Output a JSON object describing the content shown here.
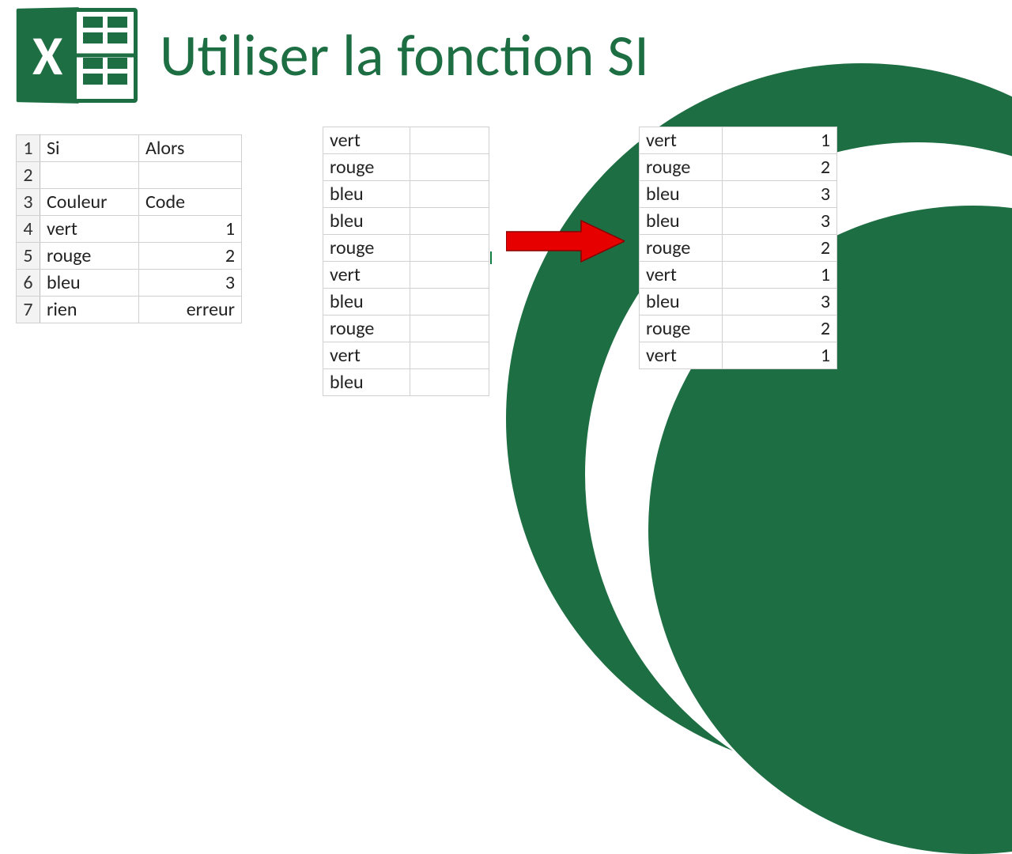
{
  "title": "Utiliser la fonction SI",
  "logo": {
    "letter": "X"
  },
  "colors": {
    "brand": "#1e6e43",
    "arrow": "#e60000"
  },
  "leftTable": {
    "rows": [
      {
        "n": "1",
        "a": "Si",
        "b": "Alors"
      },
      {
        "n": "2",
        "a": "",
        "b": ""
      },
      {
        "n": "3",
        "a": "Couleur",
        "b": "Code"
      },
      {
        "n": "4",
        "a": "vert",
        "b": "1"
      },
      {
        "n": "5",
        "a": "rouge",
        "b": "2"
      },
      {
        "n": "6",
        "a": "bleu",
        "b": "3"
      },
      {
        "n": "7",
        "a": "rien",
        "b": "erreur"
      }
    ]
  },
  "midTable": {
    "rows": [
      {
        "a": "vert",
        "b": ""
      },
      {
        "a": "rouge",
        "b": ""
      },
      {
        "a": "bleu",
        "b": ""
      },
      {
        "a": "bleu",
        "b": ""
      },
      {
        "a": "rouge",
        "b": ""
      },
      {
        "a": "vert",
        "b": ""
      },
      {
        "a": "bleu",
        "b": ""
      },
      {
        "a": "rouge",
        "b": ""
      },
      {
        "a": "vert",
        "b": ""
      },
      {
        "a": "bleu",
        "b": ""
      }
    ]
  },
  "rightTable": {
    "rows": [
      {
        "a": "vert",
        "b": "1"
      },
      {
        "a": "rouge",
        "b": "2"
      },
      {
        "a": "bleu",
        "b": "3"
      },
      {
        "a": "bleu",
        "b": "3"
      },
      {
        "a": "rouge",
        "b": "2"
      },
      {
        "a": "vert",
        "b": "1"
      },
      {
        "a": "bleu",
        "b": "3"
      },
      {
        "a": "rouge",
        "b": "2"
      },
      {
        "a": "vert",
        "b": "1"
      }
    ]
  }
}
